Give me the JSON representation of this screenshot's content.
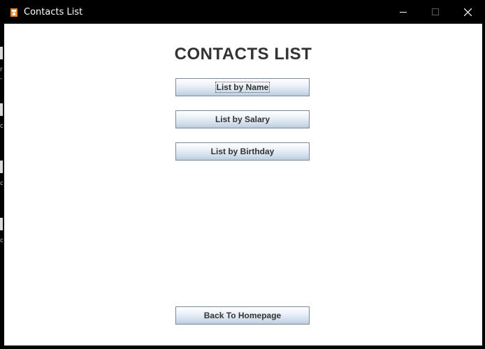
{
  "window": {
    "title": "Contacts List",
    "app_icon": "java-app-icon",
    "controls": {
      "minimize_icon": "minimize-icon",
      "maximize_icon": "maximize-icon",
      "close_icon": "close-icon"
    }
  },
  "main": {
    "heading": "CONTACTS LIST",
    "buttons": {
      "by_name": "List by Name",
      "by_salary": "List by Salary",
      "by_birthday": "List by Birthday",
      "back": "Back To Homepage"
    }
  },
  "background": {
    "text_fragments": [
      "r",
      "-(",
      "o",
      "o",
      "o"
    ]
  },
  "colors": {
    "titlebar": "#000000",
    "content_background": "#ffffff",
    "heading_text": "#333333",
    "button_border": "#7a8a99",
    "app_icon": "#e8872b"
  }
}
